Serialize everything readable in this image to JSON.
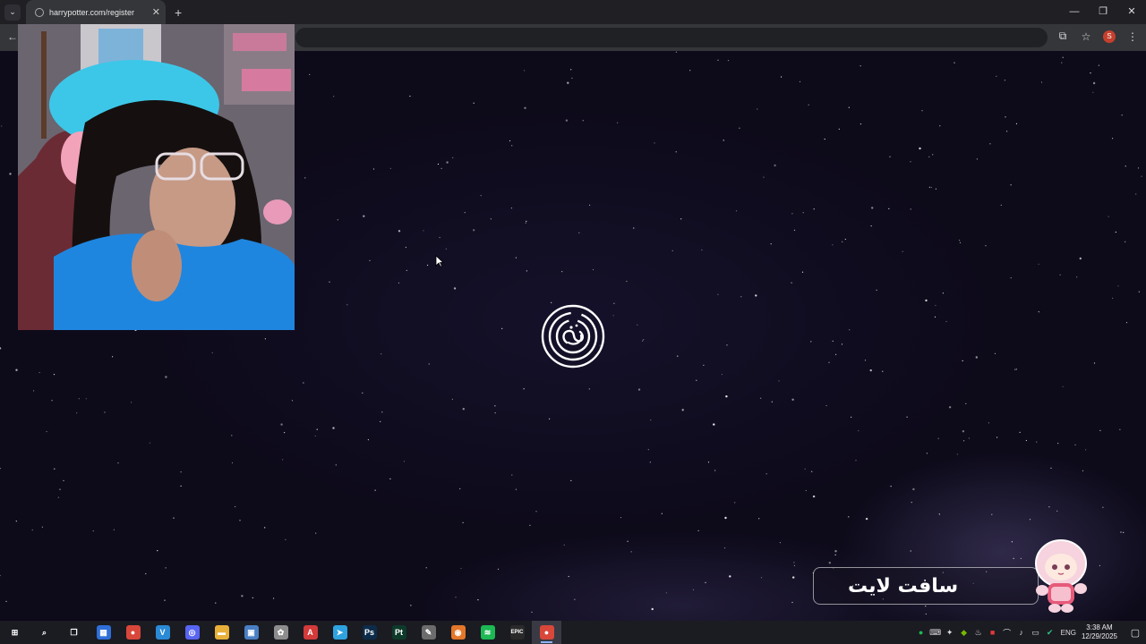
{
  "browser": {
    "tab_title": "harrypotter.com/register",
    "tab_close": "✕",
    "new_tab": "+",
    "window_controls": {
      "minimize": "—",
      "restore": "❐",
      "close": "✕"
    },
    "back": "←",
    "toolbar_icons": [
      "cast-icon",
      "star-icon",
      "profile-avatar",
      "kebab-menu-icon"
    ],
    "profile_initial": "S",
    "accent": "#8ab4f8"
  },
  "page": {
    "background": "starry night sky",
    "loader_icon": "spinner-rings-icon"
  },
  "overlay": {
    "streamer_name": "سافت لايت",
    "webcam": "webcam-feed"
  },
  "taskbar": {
    "apps": [
      {
        "name": "start",
        "glyph": "⊞",
        "color": "transparent"
      },
      {
        "name": "search",
        "glyph": "⌕",
        "color": "transparent"
      },
      {
        "name": "task-view",
        "glyph": "❐",
        "color": "transparent"
      },
      {
        "name": "store",
        "glyph": "▦",
        "color": "#2f6fd8"
      },
      {
        "name": "chrome",
        "glyph": "●",
        "color": "#d9473a"
      },
      {
        "name": "vector-app",
        "glyph": "V",
        "color": "#2a8ad6"
      },
      {
        "name": "discord",
        "glyph": "◎",
        "color": "#5865f2"
      },
      {
        "name": "file-explorer",
        "glyph": "▬",
        "color": "#e7b03a"
      },
      {
        "name": "image-app",
        "glyph": "▣",
        "color": "#4a7fc4"
      },
      {
        "name": "app",
        "glyph": "✿",
        "color": "#8d8d8d"
      },
      {
        "name": "adobe",
        "glyph": "A",
        "color": "#d33a3a"
      },
      {
        "name": "telegram",
        "glyph": "➤",
        "color": "#2ea3df"
      },
      {
        "name": "photoshop",
        "glyph": "Ps",
        "color": "#0c2c4a"
      },
      {
        "name": "substance-painter",
        "glyph": "Pt",
        "color": "#0d3a2a"
      },
      {
        "name": "brush-app",
        "glyph": "✎",
        "color": "#6c6c6c"
      },
      {
        "name": "blender",
        "glyph": "◉",
        "color": "#e4772a"
      },
      {
        "name": "spotify",
        "glyph": "≋",
        "color": "#1db954"
      },
      {
        "name": "epic-games",
        "glyph": "EPIC",
        "color": "#2a2a2a"
      },
      {
        "name": "chrome-active",
        "glyph": "●",
        "color": "#d9473a",
        "active": true
      }
    ],
    "tray": {
      "language": "ENG",
      "time": "3:38 AM",
      "date": "12/29/2025"
    }
  }
}
